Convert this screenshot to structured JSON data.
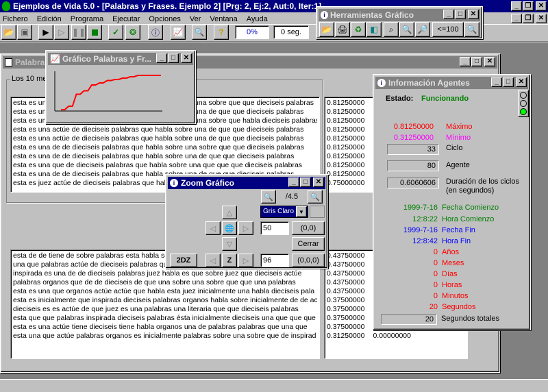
{
  "app": {
    "title": "Ejemplos de Vida 5.0 - [Palabras y Frases. Ejemplo 2] [Prg: 2, Ej:2, Aut:0, Iter:1]",
    "menu": [
      "Fichero",
      "Edición",
      "Programa",
      "Ejecutar",
      "Opciones",
      "Ver",
      "Ventana",
      "Ayuda"
    ],
    "progress": "0%",
    "timer": "0 seg."
  },
  "herramientas": {
    "title": "Herramientas Gráfico",
    "ratio": "<=100"
  },
  "palabras_window": {
    "title": "Palabras",
    "group_label": "Los 10 me",
    "top_rows": [
      "esta es una actúe de dieciseis palabras que habla sobre una sobre que que dieciseis palabras",
      "esta es una actúe de dieciseis palabras que habla sobre una de que que dieciseis palabras",
      "esta es una actúe de dieciseis palabras que habla sobre una sobre que habla dieciseis palabras",
      "esta es una actúe de dieciseis palabras que habla sobre una de que que dieciseis palabras",
      "esta es una actúe de dieciseis palabras que habla sobre una de que que dieciseis palabras",
      "esta es una de de dieciseis palabras que habla sobre una sobre que que dieciseis palabras",
      "esta es una de de dieciseis palabras que habla sobre una de que que dieciseis palabras",
      "esta es una que de dieciseis palabras que habla sobre una que que que dieciseis palabras",
      "esta es una de de dieciseis palabras que habla sobre una de que que dieciseis palabras",
      "esta es juez actúe de dieciseis palabras que habla sobre una de que que dieciseis palabras"
    ],
    "top_values": [
      "0.81250000",
      "0.81250000",
      "0.81250000",
      "0.81250000",
      "0.81250000",
      "0.81250000",
      "0.81250000",
      "0.81250000",
      "0.81250000",
      "0.75000000"
    ],
    "bottom_rows": [
      "esta de de tiene de sobre palabras esta habla sobre una sobre que que dieciseis palabras esta",
      "una que palabras actúe de dieciseis palabras que habla sobre una sobre que que dieciseis",
      "inspirada es una de de dieciseis palabras juez habla es que sobre juez que dieciseis actúe",
      "palabras organos que de de dieciseis de que una sobre una sobre que que una palabras",
      "esta es una que organos actúe actúe que habla esta juez inicialmente una habla dieciseis pala",
      "esta es inicialmente que inspirada dieciseis palabras organos habla sobre inicialmente de de ac",
      "dieciseis es es actúe de que juez es una palabras una literaria que que dieciseis palabras",
      "esta que que palabras inspirada dieciseis palabras ésta inicialmente dieciseis una que que que",
      "esta es una actúe tiene dieciseis tiene habla organos una de palabras palabras que una que",
      "esta una que actúe palabras organos es inicialmente palabras sobre una sobre que de inspirad"
    ],
    "bottom_values": [
      "0.43750000",
      "0.43750000",
      "0.43750000",
      "0.43750000",
      "0.43750000",
      "0.37500000",
      "0.37500000",
      "0.37500000",
      "0.37500000",
      "0.31250000"
    ],
    "bottom_extra": "0.00000000"
  },
  "grafico_window": {
    "title": "Gráfico Palabras y Fr...",
    "series": [
      0,
      0.1,
      0.45,
      0.55,
      0.72,
      0.78,
      0.85,
      0.88,
      0.92,
      0.96,
      1.0,
      1.0,
      1.0,
      1.0
    ]
  },
  "info_window": {
    "title": "Información Agentes",
    "estado_label": "Estado:",
    "estado_value": "Funcionando",
    "maximo_value": "0.81250000",
    "maximo_label": "Máximo",
    "minimo_value": "0.31250000",
    "minimo_label": "Mínimo",
    "ciclo_value": "33",
    "ciclo_label": "Ciclo",
    "agente_value": "80",
    "agente_label": "Agente",
    "duracion_value": "0.6060606",
    "duracion_label1": "Duración de los ciclos",
    "duracion_label2": "(en segundos)",
    "fecha_comienzo_value": "1999-7-16",
    "fecha_comienzo_label": "Fecha Comienzo",
    "hora_comienzo_value": "12:8:22",
    "hora_comienzo_label": "Hora Comienzo",
    "fecha_fin_value": "1999-7-16",
    "fecha_fin_label": "Fecha Fin",
    "hora_fin_value": "12:8:42",
    "hora_fin_label": "Hora Fin",
    "anos_value": "0",
    "anos_label": "Años",
    "meses_value": "0",
    "meses_label": "Meses",
    "dias_value": "0",
    "dias_label": "Días",
    "horas_value": "0",
    "horas_label": "Horas",
    "minutos_value": "0",
    "minutos_label": "Minutos",
    "segundos_value": "20",
    "segundos_label": "Segundos",
    "segundos_totales_value": "20",
    "segundos_totales_label": "Segundos totales"
  },
  "zoom_window": {
    "title": "Zoom Gráfico",
    "ratio": "/4.5",
    "color_select": "Gris Claro",
    "x_value": "50",
    "xy_button": "(0,0)",
    "close_button": "Cerrar",
    "mode_button": "2DZ",
    "z_label": "Z",
    "z_value": "96",
    "xyz_button": "(0,0,0)"
  },
  "colors": {
    "active_title": "#000080",
    "maximo": "#ff0000",
    "minimo": "#ff00ff",
    "green": "#008000",
    "blue": "#0000ff",
    "red": "#ff0000"
  }
}
